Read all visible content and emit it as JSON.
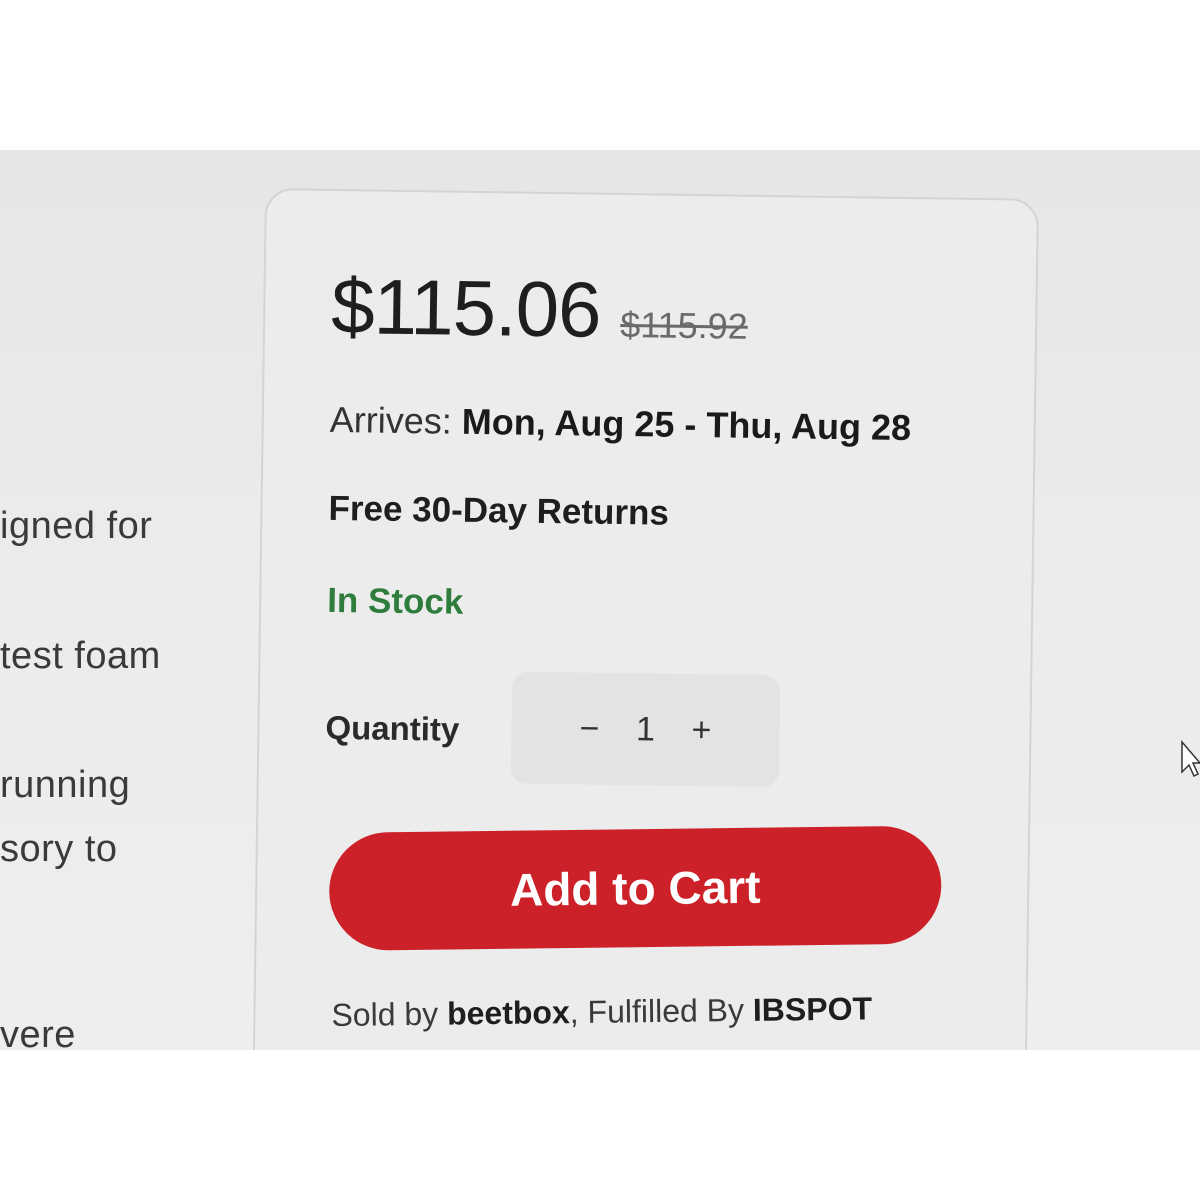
{
  "left_description": {
    "fragments": [
      "igned for",
      "test foam",
      "running",
      "sory to",
      "vere"
    ]
  },
  "product_panel": {
    "price": "$115.06",
    "original_price": "$115.92",
    "arrives_label": "Arrives:",
    "arrives_dates": "Mon, Aug 25 - Thu, Aug 28",
    "returns": "Free 30-Day Returns",
    "stock_status": "In Stock",
    "quantity_label": "Quantity",
    "quantity": {
      "decrement": "−",
      "value": "1",
      "increment": "+"
    },
    "add_to_cart_label": "Add to Cart",
    "sold_by_prefix": "Sold by",
    "seller": "beetbox",
    "fulfilled_prefix": ", Fulfilled By",
    "fulfiller": "IBSPOT"
  },
  "colors": {
    "accent_red": "#cc2129",
    "stock_green": "#2e7d3c"
  },
  "icons": {
    "cursor": "mouse-pointer-icon"
  }
}
